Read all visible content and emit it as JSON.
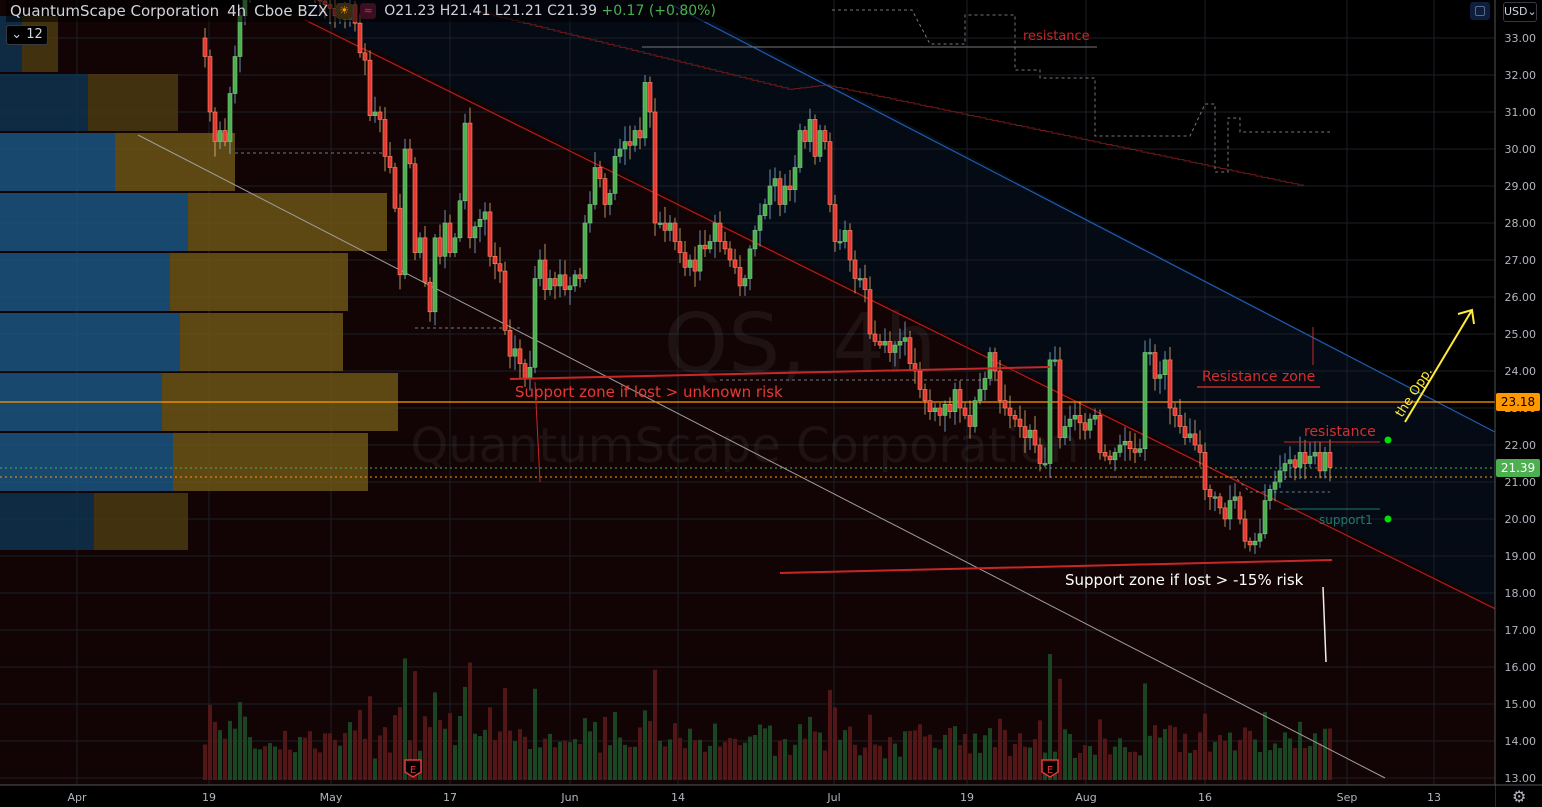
{
  "header": {
    "symbol_name": "QuantumScape Corporation",
    "interval": "4h",
    "exchange": "Cboe BZX",
    "open": "O21.23",
    "high": "H21.41",
    "low": "L21.21",
    "close": "C21.39",
    "change": "+0.17 (+0.80%)",
    "indicator_count": "12",
    "currency": "USD"
  },
  "watermark": {
    "ticker": "QS, 4h",
    "name": "QuantumScape Corporation"
  },
  "colors": {
    "up": "#4caf50",
    "down": "#e53935",
    "accent_orange": "#ff9800",
    "last_price": "#4caf50"
  },
  "chart_data": {
    "type": "candlestick",
    "title": "QuantumScape Corporation · 4h · Cboe BZX",
    "ylim": [
      13,
      33.5
    ],
    "y_ticks": [
      "33.00",
      "32.00",
      "31.00",
      "30.00",
      "29.00",
      "28.00",
      "27.00",
      "26.00",
      "25.00",
      "24.00",
      "23.00",
      "22.00",
      "21.00",
      "20.00",
      "19.00",
      "18.00",
      "17.00",
      "16.00",
      "15.00",
      "14.00",
      "13.00"
    ],
    "x_ticks": [
      "Apr",
      "19",
      "May",
      "17",
      "Jun",
      "14",
      "Jul",
      "19",
      "Aug",
      "16",
      "Sep",
      "13"
    ],
    "price_labels": {
      "horizontal_line": "23.18",
      "last_price": "21.39"
    },
    "closes": [
      32.5,
      31,
      30.2,
      30.5,
      30.2,
      31.5,
      32.5,
      33.6,
      34.2,
      34.5,
      34.8,
      35,
      34.6,
      34.9,
      35.2,
      35,
      34.7,
      34.5,
      34.8,
      35,
      34.6,
      34.4,
      34.2,
      34,
      33.9,
      33.8,
      33.6,
      33.8,
      33.5,
      33.9,
      33.4,
      32.6,
      32.4,
      30.9,
      31,
      30.8,
      29.8,
      29.5,
      28.4,
      26.6,
      30,
      29.6,
      27.2,
      27.6,
      26.4,
      25.6,
      27.6,
      27.1,
      28,
      27.2,
      27.6,
      28.6,
      30.7,
      27.6,
      27.9,
      28.1,
      28.3,
      27.1,
      26.9,
      26.7,
      25.1,
      24.4,
      24.6,
      24.2,
      23.8,
      24.1,
      26.5,
      27,
      26.2,
      26.5,
      26.3,
      26.6,
      26.2,
      26.3,
      26.6,
      26.5,
      28,
      28.5,
      29.5,
      29.2,
      28.5,
      28.8,
      29.8,
      30,
      30.2,
      30.1,
      30.5,
      30.3,
      31.8,
      31,
      28,
      28,
      27.8,
      28,
      27.5,
      27.2,
      26.8,
      27,
      26.7,
      27.4,
      27.3,
      27.5,
      28,
      27.5,
      27.3,
      27,
      26.8,
      26.3,
      26.5,
      27.3,
      27.8,
      28.2,
      28.5,
      29,
      29.2,
      28.5,
      29,
      28.9,
      29.5,
      30.5,
      30.2,
      30.8,
      29.8,
      30.5,
      30.2,
      28.5,
      27.5,
      27.5,
      27.8,
      27,
      26.5,
      26.5,
      26.2,
      25,
      24.8,
      24.7,
      24.8,
      24.5,
      24.7,
      24.8,
      24.9,
      24.2,
      24,
      23.5,
      23.2,
      22.9,
      23,
      22.8,
      23.1,
      22.9,
      23.5,
      23,
      22.8,
      22.5,
      23.2,
      23.5,
      23.8,
      24.5,
      24,
      23.2,
      23,
      22.8,
      22.7,
      22.5,
      22.2,
      22.4,
      22,
      21.5,
      21.5,
      24.3,
      24.3,
      22.2,
      22.5,
      22.7,
      22.8,
      22.6,
      22.4,
      22.7,
      22.8,
      21.8,
      21.7,
      21.6,
      21.8,
      22,
      22.1,
      21.9,
      21.8,
      21.9,
      24.5,
      24.5,
      23.8,
      23.9,
      24.3,
      23,
      22.8,
      22.5,
      22.2,
      22.3,
      22,
      21.8,
      20.8,
      20.6,
      20.6,
      20.3,
      20,
      20.5,
      20.6,
      20,
      19.4,
      19.3,
      19.4,
      19.6,
      20.5,
      20.8,
      21,
      21.3,
      21.5,
      21.6,
      21.4,
      21.8,
      21.5,
      21.7,
      21.8,
      21.3,
      21.8,
      21.39
    ],
    "annotations": {
      "resistance_top": "resistance",
      "support_unknown": "Support zone if lost > unknown risk",
      "resistance_zone": "Resistance zone",
      "resistance_near": "resistance",
      "support1": "support1",
      "support_15": "Support zone if lost > -15% risk",
      "opportunity": "the Opp."
    },
    "earnings_marker": "E"
  }
}
